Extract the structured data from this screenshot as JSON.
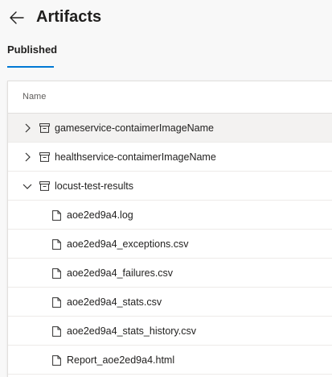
{
  "header": {
    "title": "Artifacts",
    "back_icon": "arrow-left-icon"
  },
  "tabs": [
    {
      "label": "Published",
      "selected": true
    }
  ],
  "table": {
    "column_header": "Name",
    "folders": [
      {
        "label": "gameservice-contaimerImageName",
        "expanded": false,
        "selected": true
      },
      {
        "label": "healthservice-contaimerImageName",
        "expanded": false,
        "selected": false
      },
      {
        "label": "locust-test-results",
        "expanded": true,
        "selected": false
      }
    ],
    "files": [
      {
        "label": "aoe2ed9a4.log"
      },
      {
        "label": "aoe2ed9a4_exceptions.csv"
      },
      {
        "label": "aoe2ed9a4_failures.csv"
      },
      {
        "label": "aoe2ed9a4_stats.csv"
      },
      {
        "label": "aoe2ed9a4_stats_history.csv"
      },
      {
        "label": "Report_aoe2ed9a4.html"
      }
    ]
  },
  "colors": {
    "accent": "#0078d4",
    "text": "#201f1e",
    "secondary_text": "#605e5c",
    "selected_row": "#f3f2f1",
    "background": "#f8f8f8"
  }
}
